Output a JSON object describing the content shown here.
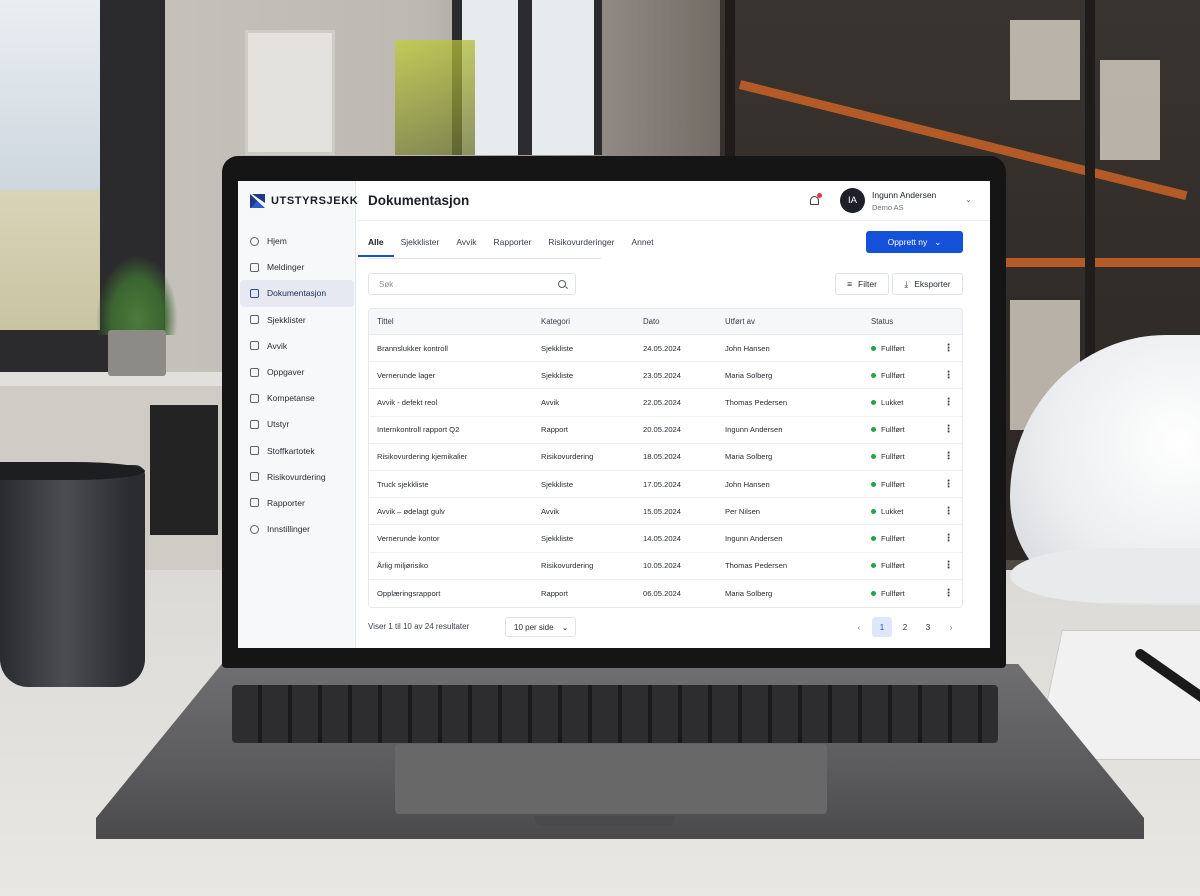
{
  "app": {
    "logo_text": "UTSTYRSJEKK"
  },
  "sidebar": {
    "items": [
      {
        "label": "Hjem",
        "icon": "home-icon"
      },
      {
        "label": "Meldinger",
        "icon": "message-icon"
      },
      {
        "label": "Dokumentasjon",
        "icon": "document-icon",
        "active": true
      },
      {
        "label": "Sjekklister",
        "icon": "checklist-icon"
      },
      {
        "label": "Avvik",
        "icon": "pen-icon"
      },
      {
        "label": "Oppgaver",
        "icon": "task-icon"
      },
      {
        "label": "Kompetanse",
        "icon": "graduation-icon"
      },
      {
        "label": "Utstyr",
        "icon": "equipment-icon"
      },
      {
        "label": "Stoffkartotek",
        "icon": "archive-icon"
      },
      {
        "label": "Risikovurdering",
        "icon": "risk-icon"
      },
      {
        "label": "Rapporter",
        "icon": "report-icon"
      },
      {
        "label": "Innstillinger",
        "icon": "gear-icon"
      }
    ]
  },
  "header": {
    "title": "Dokumentasjon",
    "user_initials": "IA",
    "user_name": "Ingunn Andersen",
    "user_org": "Demo AS"
  },
  "tabs": [
    "Alle",
    "Sjekklister",
    "Avvik",
    "Rapporter",
    "Risikovurderinger",
    "Annet"
  ],
  "actions": {
    "create_label": "Opprett ny",
    "filter_label": "Filter",
    "export_label": "Eksporter"
  },
  "search": {
    "placeholder": "Søk"
  },
  "table": {
    "columns": [
      "Tittel",
      "Kategori",
      "Dato",
      "Utført av",
      "Status"
    ],
    "rows": [
      [
        "Brannslukker kontroll",
        "Sjekkliste",
        "24.05.2024",
        "John Hansen",
        "Fullført"
      ],
      [
        "Vernerunde lager",
        "Sjekkliste",
        "23.05.2024",
        "Maria Solberg",
        "Fullført"
      ],
      [
        "Avvik - defekt reol",
        "Avvik",
        "22.05.2024",
        "Thomas Pedersen",
        "Lukket"
      ],
      [
        "Internkontroll rapport Q2",
        "Rapport",
        "20.05.2024",
        "Ingunn Andersen",
        "Fullført"
      ],
      [
        "Risikovurdering kjemikalier",
        "Risikovurdering",
        "18.05.2024",
        "Maria Solberg",
        "Fullført"
      ],
      [
        "Truck sjekkliste",
        "Sjekkliste",
        "17.05.2024",
        "John Hansen",
        "Fullført"
      ],
      [
        "Avvik – ødelagt gulv",
        "Avvik",
        "15.05.2024",
        "Per Nilsen",
        "Lukket"
      ],
      [
        "Vernerunde kontor",
        "Sjekkliste",
        "14.05.2024",
        "Ingunn Andersen",
        "Fullført"
      ],
      [
        "Årlig miljørisiko",
        "Risikovurdering",
        "10.05.2024",
        "Thomas Pedersen",
        "Fullført"
      ],
      [
        "Opplæringsrapport",
        "Rapport",
        "06.05.2024",
        "Maria Solberg",
        "Fullført"
      ]
    ]
  },
  "footer": {
    "results_text": "Viser 1 til 10 av 24 resultater",
    "per_page": "10 per side",
    "pages": [
      "1",
      "2",
      "3"
    ],
    "current_page": "1"
  },
  "colors": {
    "accent": "#1550d8",
    "status_ok": "#22a34a"
  }
}
